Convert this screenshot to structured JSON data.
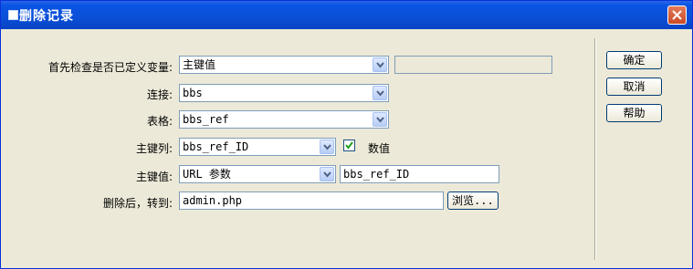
{
  "window": {
    "title": "删除记录"
  },
  "form": {
    "check_variable": {
      "label": "首先检查是否已定义变量:",
      "value": "主键值",
      "extra_value": ""
    },
    "connection": {
      "label": "连接:",
      "value": "bbs"
    },
    "table": {
      "label": "表格:",
      "value": "bbs_ref"
    },
    "primary_key_column": {
      "label": "主键列:",
      "value": "bbs_ref_ID",
      "numeric_label": "数值",
      "numeric_checked": true
    },
    "primary_key_value": {
      "label": "主键值:",
      "value": "URL 参数",
      "param": "bbs_ref_ID"
    },
    "redirect": {
      "label": "删除后，转到:",
      "value": "admin.php",
      "browse_label": "浏览..."
    }
  },
  "buttons": {
    "ok": "确定",
    "cancel": "取消",
    "help": "帮助"
  }
}
